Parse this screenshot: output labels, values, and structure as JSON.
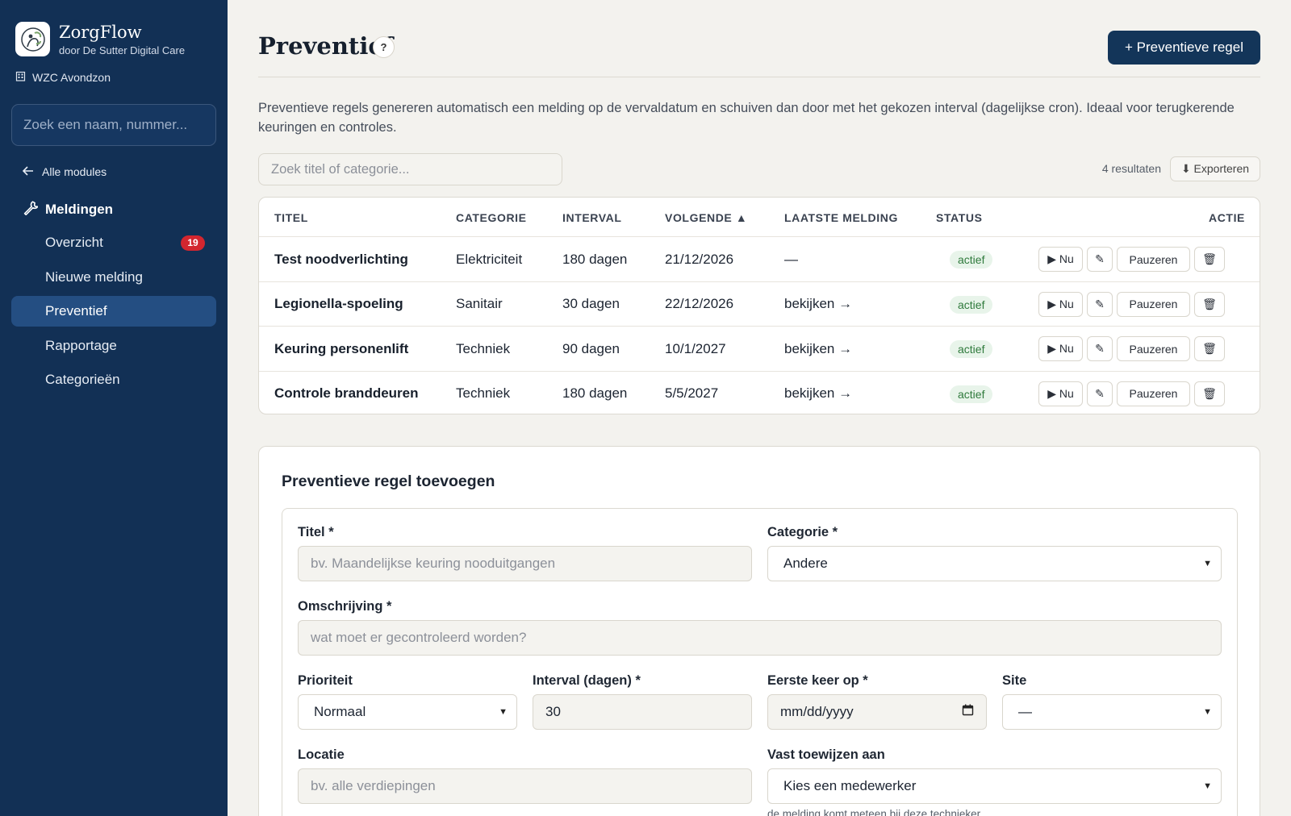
{
  "brand": {
    "name": "ZorgFlow",
    "subtitle": "door De Sutter Digital Care"
  },
  "org": "WZC Avondzon",
  "sidebar": {
    "search_placeholder": "Zoek een naam, nummer...",
    "back_label": "Alle modules",
    "module_label": "Meldingen",
    "items": [
      {
        "label": "Overzicht",
        "badge": "19"
      },
      {
        "label": "Nieuwe melding"
      },
      {
        "label": "Preventief",
        "active": true
      },
      {
        "label": "Rapportage"
      },
      {
        "label": "Categorieën"
      }
    ]
  },
  "page": {
    "title": "Preventief",
    "help": "?",
    "primary_button": "+ Preventieve regel",
    "intro": "Preventieve regels genereren automatisch een melding op de vervaldatum en schuiven dan door met het gekozen interval (dagelijkse cron). Ideaal voor terugkerende keuringen en controles."
  },
  "table": {
    "search_placeholder": "Zoek titel of categorie...",
    "results": "4 resultaten",
    "export_label": "⬇ Exporteren",
    "columns": [
      "TITEL",
      "CATEGORIE",
      "INTERVAL",
      "VOLGENDE ▲",
      "LAATSTE MELDING",
      "STATUS",
      "ACTIE"
    ],
    "rows": [
      {
        "title": "Test noodverlichting",
        "category": "Elektriciteit",
        "interval": "180 dagen",
        "next": "21/12/2026",
        "last": "—",
        "status": "actief"
      },
      {
        "title": "Legionella-spoeling",
        "category": "Sanitair",
        "interval": "30 dagen",
        "next": "22/12/2026",
        "last": "bekijken →",
        "status": "actief"
      },
      {
        "title": "Keuring personenlift",
        "category": "Techniek",
        "interval": "90 dagen",
        "next": "10/1/2027",
        "last": "bekijken →",
        "status": "actief"
      },
      {
        "title": "Controle branddeuren",
        "category": "Techniek",
        "interval": "180 dagen",
        "next": "5/5/2027",
        "last": "bekijken →",
        "status": "actief"
      }
    ],
    "actions": {
      "run": "▶ Nu",
      "edit": "✎",
      "pause": "Pauzeren",
      "delete": "🗑"
    }
  },
  "form": {
    "title": "Preventieve regel toevoegen",
    "titel_label": "Titel *",
    "titel_placeholder": "bv. Maandelijkse keuring nooduitgangen",
    "categorie_label": "Categorie *",
    "categorie_value": "Andere",
    "omschrijving_label": "Omschrijving *",
    "omschrijving_placeholder": "wat moet er gecontroleerd worden?",
    "prioriteit_label": "Prioriteit",
    "prioriteit_value": "Normaal",
    "interval_label": "Interval (dagen) *",
    "interval_value": "30",
    "eerste_label": "Eerste keer op *",
    "eerste_placeholder": "mm/dd/yyyy",
    "site_label": "Site",
    "site_value": "—",
    "locatie_label": "Locatie",
    "locatie_placeholder": "bv. alle verdiepingen",
    "toewijzen_label": "Vast toewijzen aan",
    "toewijzen_value": "Kies een medewerker",
    "toewijzen_hint": "de melding komt meteen bij deze technieker"
  },
  "colors": {
    "sidebar": "#123055",
    "accent": "#133559",
    "active_nav": "#244e82",
    "badge": "#d3262f",
    "status_bg": "#e8f4ea",
    "status_text": "#2f7a3c"
  }
}
